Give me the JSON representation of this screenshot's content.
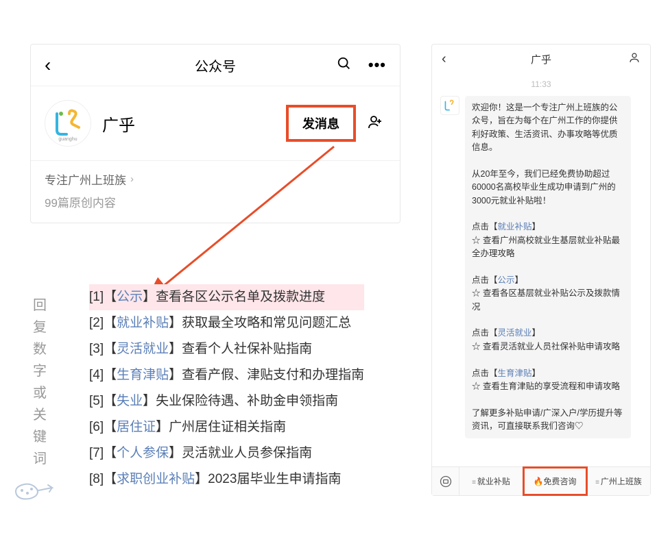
{
  "profile": {
    "header_title": "公众号",
    "account_name": "广乎",
    "avatar_label": "guanghu",
    "msg_button": "发消息",
    "tagline": "专注广州上班族",
    "article_count": "99篇原创内容"
  },
  "reply_label_chars": [
    "回",
    "复",
    "数",
    "字",
    "或",
    "关",
    "键",
    "词"
  ],
  "reply_items": [
    {
      "num": "[1]",
      "keyword": "公示",
      "desc": "查看各区公示名单及拨款进度",
      "highlighted": true
    },
    {
      "num": "[2]",
      "keyword": "就业补贴",
      "desc": "获取最全攻略和常见问题汇总",
      "highlighted": false
    },
    {
      "num": "[3]",
      "keyword": "灵活就业",
      "desc": "查看个人社保补贴指南",
      "highlighted": false
    },
    {
      "num": "[4]",
      "keyword": "生育津贴",
      "desc": "查看产假、津贴支付和办理指南",
      "highlighted": false
    },
    {
      "num": "[5]",
      "keyword": "失业",
      "desc": "失业保险待遇、补助金申领指南",
      "highlighted": false
    },
    {
      "num": "[6]",
      "keyword": "居住证",
      "desc": "广州居住证相关指南",
      "highlighted": false
    },
    {
      "num": "[7]",
      "keyword": "个人参保",
      "desc": "灵活就业人员参保指南",
      "highlighted": false
    },
    {
      "num": "[8]",
      "keyword": "求职创业补贴",
      "desc": "2023届毕业生申请指南",
      "highlighted": false
    }
  ],
  "chat": {
    "title": "广乎",
    "time": "11:33",
    "welcome_p1": "欢迎你！这是一个专注广州上班族的公众号，旨在为每个在广州工作的你提供利好政策、生活资讯、办事攻略等优质信息。",
    "welcome_p2": "从20年至今，我们已经免费协助超过60000名高校毕业生成功申请到广州的3000元就业补贴啦！",
    "link1_prefix": "点击【",
    "link1": "就业补贴",
    "link1_suffix": "】",
    "link1_desc": "☆ 查看广州高校就业生基层就业补贴最全办理攻略",
    "link2_prefix": "点击【",
    "link2": "公示",
    "link2_suffix": "】",
    "link2_desc": "☆ 查看各区基层就业补贴公示及拨款情况",
    "link3_prefix": "点击【",
    "link3": "灵活就业",
    "link3_suffix": "】",
    "link3_desc": "☆ 查看灵活就业人员社保补贴申请攻略",
    "link4_prefix": "点击【",
    "link4": "生育津贴",
    "link4_suffix": "】",
    "link4_desc": "☆ 查看生育津贴的享受流程和申请攻略",
    "footer": "了解更多补贴申请/广深入户/学历提升等资讯，可直接联系我们咨询♡",
    "menu": [
      {
        "label": "就业补贴",
        "fire": false,
        "hl": false,
        "mini": true
      },
      {
        "label": "免费咨询",
        "fire": true,
        "hl": true,
        "mini": false
      },
      {
        "label": "广州上班族",
        "fire": false,
        "hl": false,
        "mini": true
      }
    ]
  }
}
